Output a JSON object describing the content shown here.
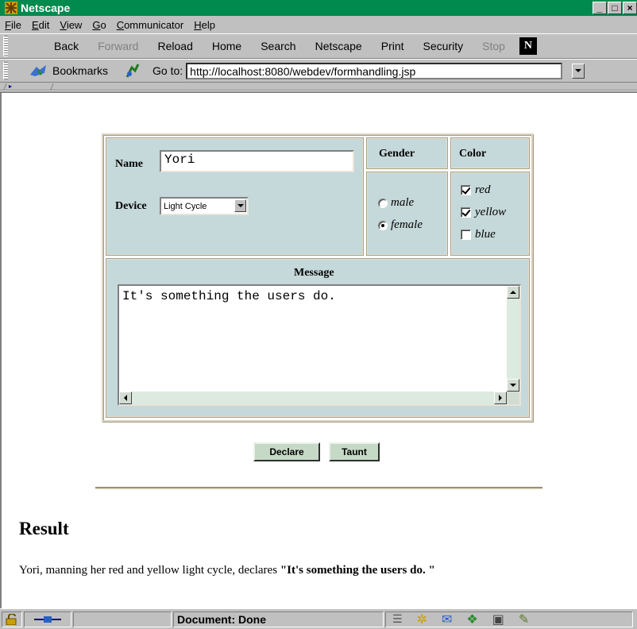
{
  "window": {
    "title": "Netscape",
    "controls": [
      "_",
      "□",
      "x"
    ]
  },
  "menu": [
    {
      "label": "File",
      "u": "F",
      "rest": "ile"
    },
    {
      "label": "Edit",
      "u": "E",
      "rest": "dit"
    },
    {
      "label": "View",
      "u": "V",
      "rest": "iew"
    },
    {
      "label": "Go",
      "u": "G",
      "rest": "o"
    },
    {
      "label": "Communicator",
      "u": "C",
      "rest": "ommunicator"
    },
    {
      "label": "Help",
      "u": "H",
      "rest": "elp"
    }
  ],
  "nav": {
    "back": "Back",
    "forward": "Forward",
    "reload": "Reload",
    "home": "Home",
    "search": "Search",
    "netscape": "Netscape",
    "print": "Print",
    "security": "Security",
    "stop": "Stop",
    "logo": "N"
  },
  "location": {
    "bookmarks": "Bookmarks",
    "goto_label": "Go to:",
    "url": "http://localhost:8080/webdev/formhandling.jsp"
  },
  "form": {
    "name_label": "Name",
    "name_value": "Yori",
    "device_label": "Device",
    "device_value": "Light Cycle",
    "gender_header": "Gender",
    "gender_options": [
      {
        "label": "male",
        "checked": false
      },
      {
        "label": "female",
        "checked": true
      }
    ],
    "color_header": "Color",
    "color_options": [
      {
        "label": "red",
        "checked": true
      },
      {
        "label": "yellow",
        "checked": true
      },
      {
        "label": "blue",
        "checked": false
      }
    ],
    "message_label": "Message",
    "message_value": "It's something the users do.",
    "declare_button": "Declare",
    "taunt_button": "Taunt"
  },
  "result": {
    "heading": "Result",
    "text_prefix": "Yori, manning her  red and yellow  light cycle, declares ",
    "quote": "\"It's something the users do. \""
  },
  "status": {
    "text": "Document: Done"
  }
}
